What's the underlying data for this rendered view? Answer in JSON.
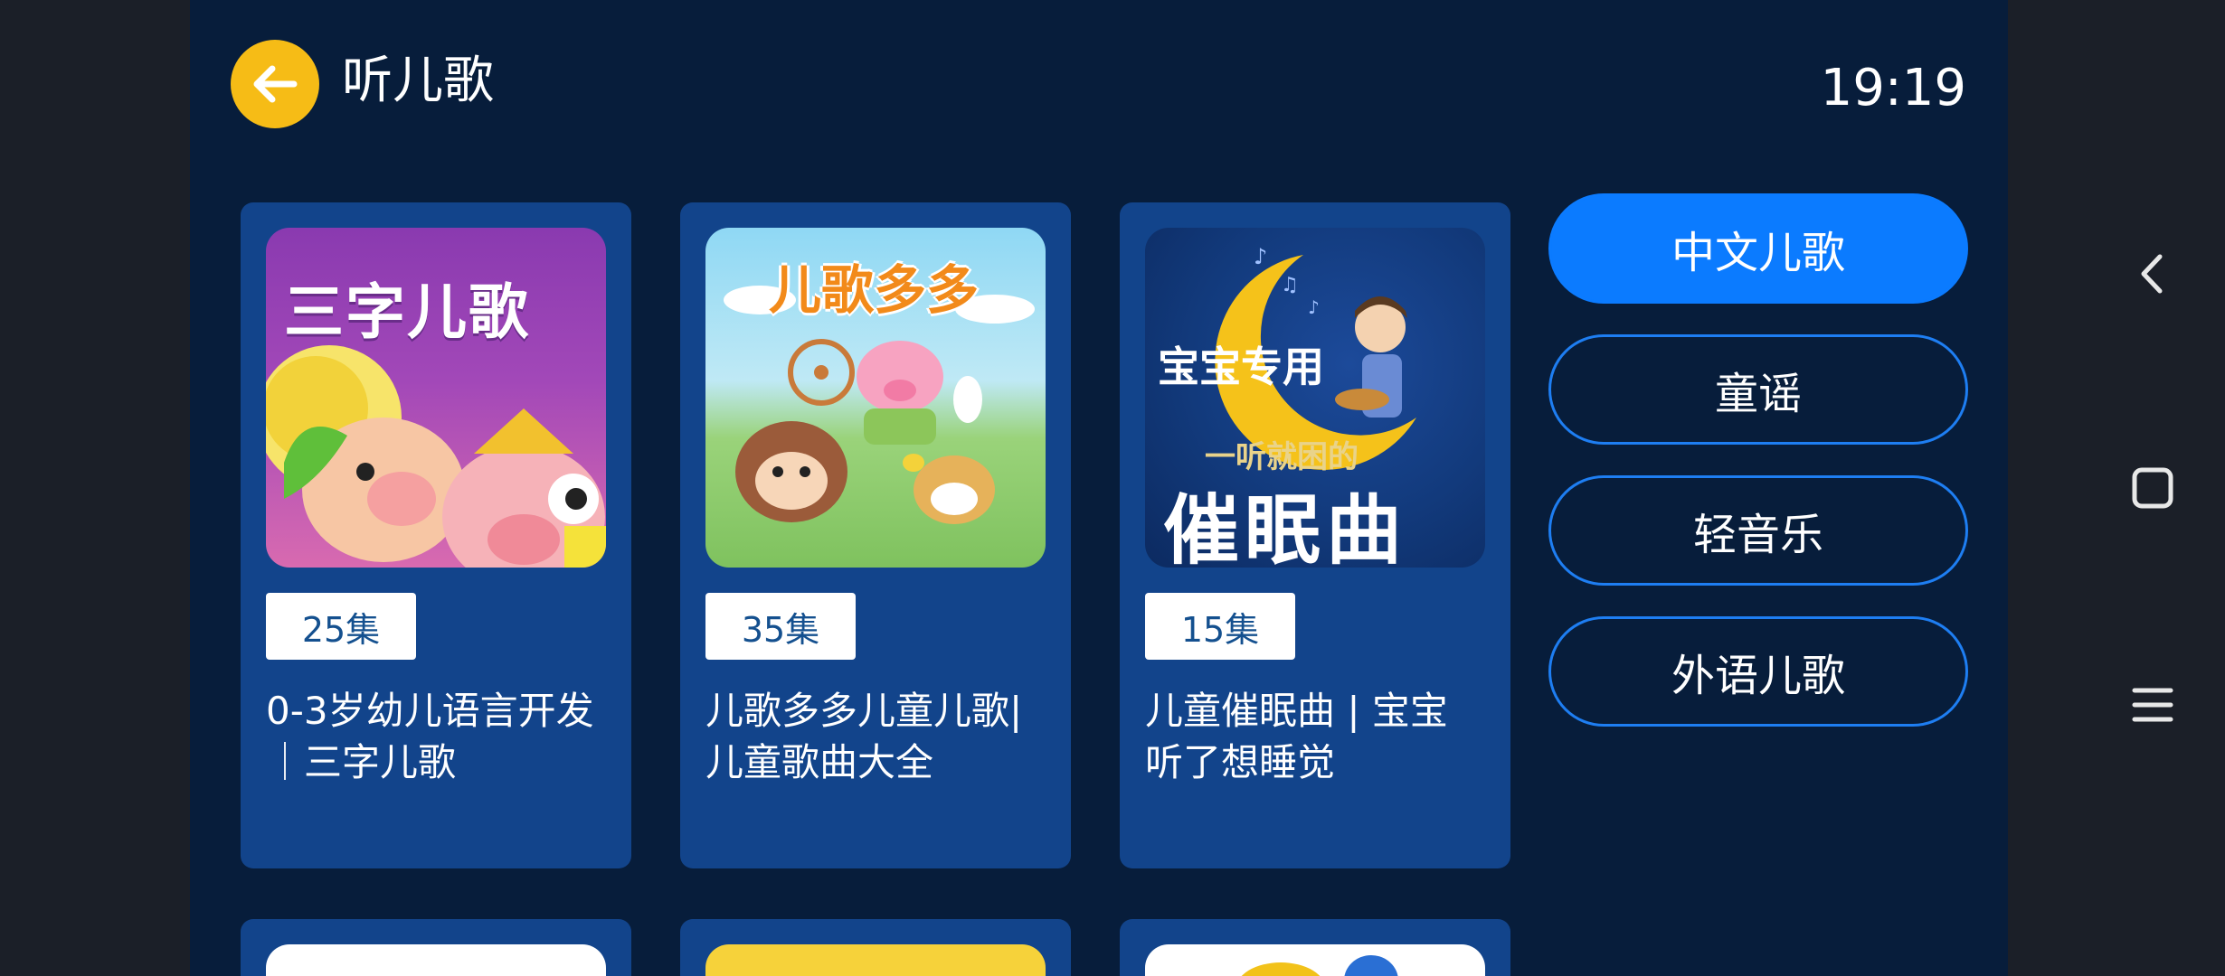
{
  "header": {
    "back_icon": "arrow-left-icon",
    "title": "听儿歌",
    "time": "19:19"
  },
  "albums": [
    {
      "episodes": "25集",
      "title": "0-3岁幼儿语言开发｜三字儿歌",
      "cover_text": "三字儿歌"
    },
    {
      "episodes": "35集",
      "title": "儿歌多多儿童儿歌|儿童歌曲大全",
      "cover_text": "儿歌多多"
    },
    {
      "episodes": "15集",
      "title": "儿童催眠曲 | 宝宝听了想睡觉",
      "cover_text_1": "宝宝专用",
      "cover_text_2": "一听就困的",
      "cover_text_3": "催眠曲"
    }
  ],
  "categories": [
    {
      "label": "中文儿歌",
      "active": true
    },
    {
      "label": "童谣",
      "active": false
    },
    {
      "label": "轻音乐",
      "active": false
    },
    {
      "label": "外语儿歌",
      "active": false
    }
  ],
  "system_nav": [
    "back-icon",
    "home-icon",
    "menu-icon"
  ],
  "colors": {
    "background": "#071d3b",
    "card": "#12448b",
    "accent": "#0b7bff",
    "back_button": "#f6bc16"
  }
}
